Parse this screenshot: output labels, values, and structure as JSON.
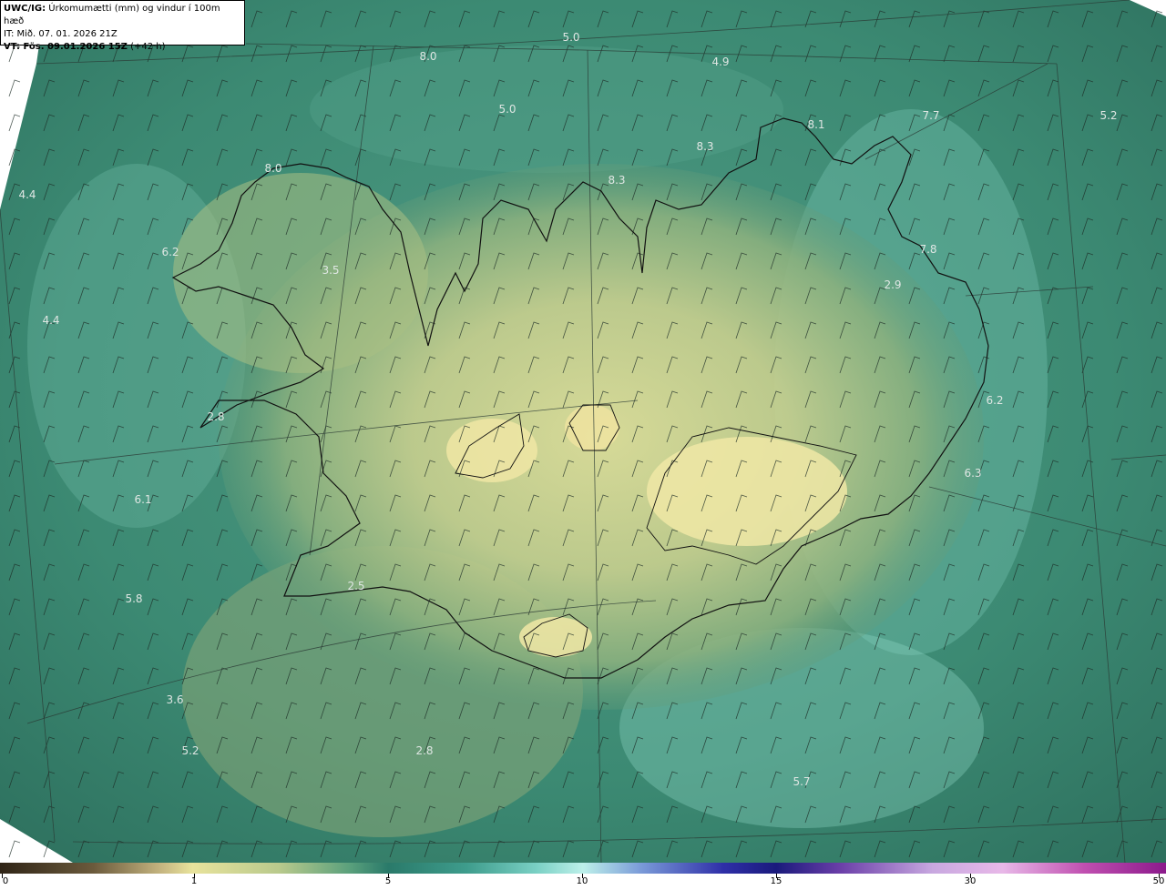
{
  "info": {
    "model": "UWC/IG:",
    "title": "Úrkomumætti (mm) og vindur í 100m hæð",
    "it": "IT: Mið. 07. 01. 2026 21Z",
    "vt_label": "VT: Fös. 09.01.2026 15Z",
    "vt_extra": " (+42 h)"
  },
  "map_labels": [
    {
      "text": "5.0",
      "pos": [
        627,
        41
      ]
    },
    {
      "text": "8.0",
      "pos": [
        470,
        62
      ]
    },
    {
      "text": "4.9",
      "pos": [
        791,
        68
      ]
    },
    {
      "text": "5.0",
      "pos": [
        557,
        120
      ]
    },
    {
      "text": "7.7",
      "pos": [
        1022,
        127
      ]
    },
    {
      "text": "5.2",
      "pos": [
        1217,
        127
      ]
    },
    {
      "text": "8.1",
      "pos": [
        896,
        137
      ]
    },
    {
      "text": "8.3",
      "pos": [
        774,
        161
      ]
    },
    {
      "text": "8.0",
      "pos": [
        300,
        185
      ]
    },
    {
      "text": "8.3",
      "pos": [
        677,
        198
      ]
    },
    {
      "text": "4.4",
      "pos": [
        30,
        214
      ]
    },
    {
      "text": "7.8",
      "pos": [
        1019,
        274
      ]
    },
    {
      "text": "6.2",
      "pos": [
        187,
        277
      ]
    },
    {
      "text": "3.5",
      "pos": [
        363,
        297
      ]
    },
    {
      "text": "2.9",
      "pos": [
        980,
        313
      ]
    },
    {
      "text": "4.4",
      "pos": [
        56,
        352
      ]
    },
    {
      "text": "6.2",
      "pos": [
        1092,
        440
      ]
    },
    {
      "text": "2.8",
      "pos": [
        237,
        458
      ]
    },
    {
      "text": "6.3",
      "pos": [
        1068,
        520
      ]
    },
    {
      "text": "6.1",
      "pos": [
        157,
        549
      ]
    },
    {
      "text": "2.5",
      "pos": [
        391,
        644
      ]
    },
    {
      "text": "5.8",
      "pos": [
        147,
        658
      ]
    },
    {
      "text": "3.6",
      "pos": [
        192,
        769
      ]
    },
    {
      "text": "5.2",
      "pos": [
        209,
        825
      ]
    },
    {
      "text": "2.8",
      "pos": [
        466,
        825
      ]
    },
    {
      "text": "5.7",
      "pos": [
        880,
        859
      ]
    }
  ],
  "colorbar": {
    "ticks": [
      "0",
      "1",
      "5",
      "10",
      "15",
      "30",
      "50"
    ]
  },
  "colors": {
    "sea_dark": "#2f7a66",
    "sea_mid": "#3f8f7a",
    "sea_light": "#7fc9b8",
    "land_low": "#7aa576",
    "land_high": "#d8d592",
    "coast": "#111111",
    "grid": "#333333"
  }
}
